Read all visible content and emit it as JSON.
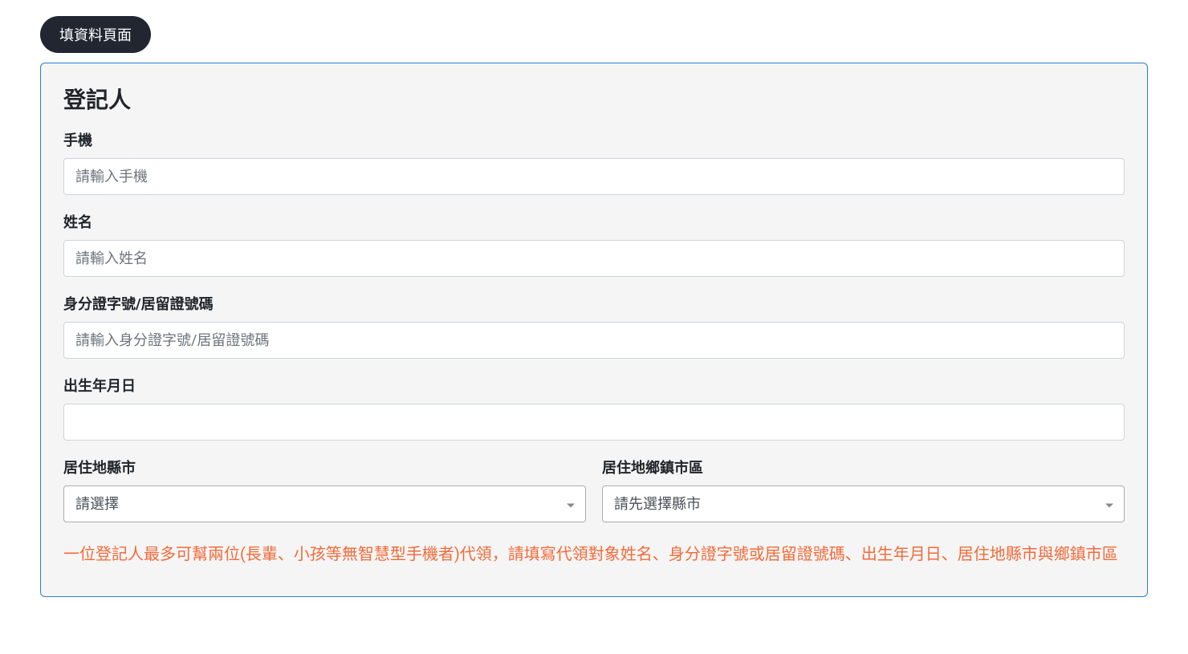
{
  "tab_label": "填資料頁面",
  "section_title": "登記人",
  "fields": {
    "phone": {
      "label": "手機",
      "placeholder": "請輸入手機"
    },
    "name": {
      "label": "姓名",
      "placeholder": "請輸入姓名"
    },
    "id_number": {
      "label": "身分證字號/居留證號碼",
      "placeholder": "請輸入身分證字號/居留證號碼"
    },
    "birthdate": {
      "label": "出生年月日"
    },
    "city": {
      "label": "居住地縣市",
      "placeholder": "請選擇"
    },
    "district": {
      "label": "居住地鄉鎮市區",
      "placeholder": "請先選擇縣市"
    }
  },
  "notice": "一位登記人最多可幫兩位(長輩、小孩等無智慧型手機者)代領，請填寫代領對象姓名、身分證字號或居留證號碼、出生年月日、居住地縣市與鄉鎮市區"
}
